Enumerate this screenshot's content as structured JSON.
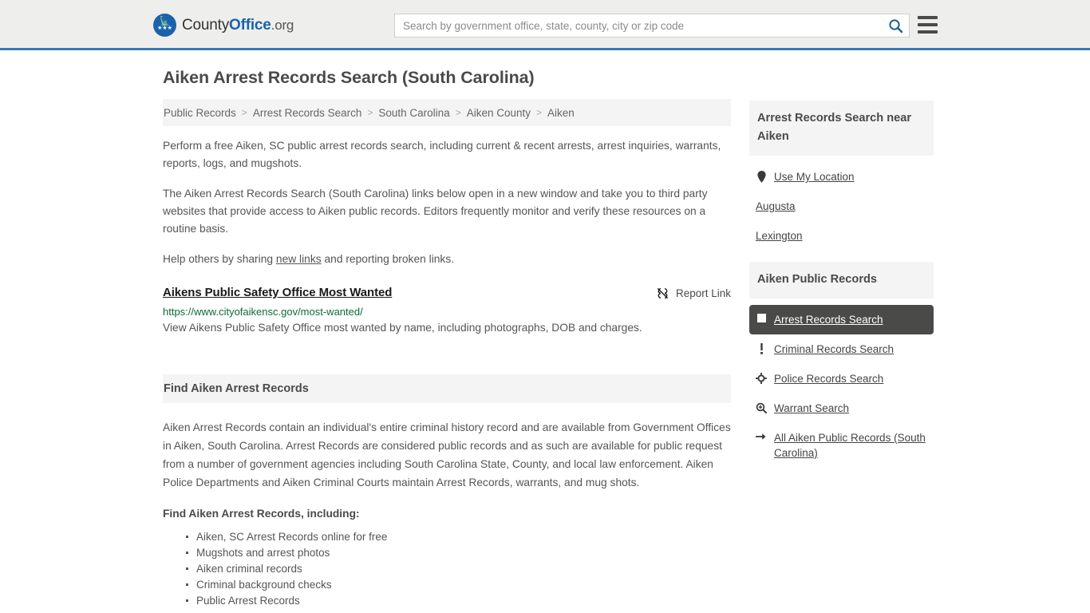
{
  "header": {
    "logo": {
      "text_1": "County",
      "text_2": "Office",
      "text_3": ".org",
      "icon": "eagle-stars-seal-icon"
    },
    "search": {
      "placeholder": "Search by government office, state, county, city or zip code",
      "value": "",
      "icon": "search-icon"
    },
    "menu_icon": "hamburger-menu-icon"
  },
  "main": {
    "title": "Aiken Arrest Records Search (South Carolina)",
    "breadcrumb": {
      "separator": ">",
      "items": [
        "Public Records",
        "Arrest Records Search",
        "South Carolina",
        "Aiken County",
        "Aiken"
      ]
    },
    "intro_paragraphs": [
      "Perform a free Aiken, SC public arrest records search, including current & recent arrests, arrest inquiries, warrants, reports, logs, and mugshots.",
      "The Aiken Arrest Records Search (South Carolina) links below open in a new window and take you to third party websites that provide access to Aiken public records. Editors frequently monitor and verify these resources on a routine basis."
    ],
    "help_line": {
      "before": "Help others by sharing ",
      "link": "new links",
      "after": " and reporting broken links."
    },
    "result": {
      "title": "Aikens Public Safety Office Most Wanted",
      "url": "https://www.cityofaikensc.gov/most-wanted/",
      "description": "View Aikens Public Safety Office most wanted by name, including photographs, DOB and charges.",
      "report_label": "Report Link",
      "report_icon": "broken-link-icon"
    },
    "section": {
      "heading": "Find Aiken Arrest Records",
      "body": "Aiken Arrest Records contain an individual's entire criminal history record and are available from Government Offices in Aiken, South Carolina. Arrest Records are considered public records and as such are available for public request from a number of government agencies including South Carolina State, County, and local law enforcement. Aiken Police Departments and Aiken Criminal Courts maintain Arrest Records, warrants, and mug shots.",
      "sub_heading": "Find Aiken Arrest Records, including:",
      "bullets": [
        "Aiken, SC Arrest Records online for free",
        "Mugshots and arrest photos",
        "Aiken criminal records",
        "Criminal background checks",
        "Public Arrest Records"
      ]
    }
  },
  "sidebar": {
    "near_section": {
      "heading": "Arrest Records Search near Aiken",
      "items": [
        {
          "label": "Use My Location",
          "icon": "map-pin-icon"
        },
        {
          "label": "Augusta",
          "icon": ""
        },
        {
          "label": "Lexington",
          "icon": ""
        }
      ]
    },
    "records_section": {
      "heading": "Aiken Public Records",
      "items": [
        {
          "label": "Arrest Records Search",
          "icon": "square-icon",
          "active": true
        },
        {
          "label": "Criminal Records Search",
          "icon": "exclamation-icon",
          "active": false
        },
        {
          "label": "Police Records Search",
          "icon": "crosshair-icon",
          "active": false
        },
        {
          "label": "Warrant Search",
          "icon": "magnifier-plus-icon",
          "active": false
        },
        {
          "label": "All Aiken Public Records (South Carolina)",
          "icon": "arrow-right-icon",
          "active": false
        }
      ]
    }
  },
  "colors": {
    "header_bg": "#eeeeec",
    "header_border": "#3b78b0",
    "brand_blue": "#1b62ac",
    "url_green": "#0e6b33",
    "active_item_bg": "#4a4a48",
    "band_bg": "#f4f4f4"
  }
}
